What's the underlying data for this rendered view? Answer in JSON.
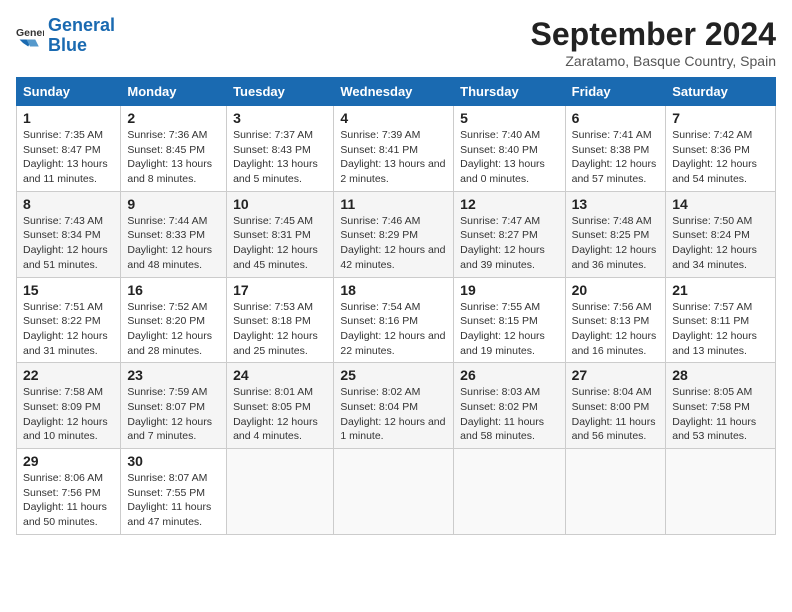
{
  "logo": {
    "name_part1": "General",
    "name_part2": "Blue"
  },
  "title": "September 2024",
  "location": "Zaratamo, Basque Country, Spain",
  "weekdays": [
    "Sunday",
    "Monday",
    "Tuesday",
    "Wednesday",
    "Thursday",
    "Friday",
    "Saturday"
  ],
  "weeks": [
    [
      {
        "day": "1",
        "sunrise": "Sunrise: 7:35 AM",
        "sunset": "Sunset: 8:47 PM",
        "daylight": "Daylight: 13 hours and 11 minutes."
      },
      {
        "day": "2",
        "sunrise": "Sunrise: 7:36 AM",
        "sunset": "Sunset: 8:45 PM",
        "daylight": "Daylight: 13 hours and 8 minutes."
      },
      {
        "day": "3",
        "sunrise": "Sunrise: 7:37 AM",
        "sunset": "Sunset: 8:43 PM",
        "daylight": "Daylight: 13 hours and 5 minutes."
      },
      {
        "day": "4",
        "sunrise": "Sunrise: 7:39 AM",
        "sunset": "Sunset: 8:41 PM",
        "daylight": "Daylight: 13 hours and 2 minutes."
      },
      {
        "day": "5",
        "sunrise": "Sunrise: 7:40 AM",
        "sunset": "Sunset: 8:40 PM",
        "daylight": "Daylight: 13 hours and 0 minutes."
      },
      {
        "day": "6",
        "sunrise": "Sunrise: 7:41 AM",
        "sunset": "Sunset: 8:38 PM",
        "daylight": "Daylight: 12 hours and 57 minutes."
      },
      {
        "day": "7",
        "sunrise": "Sunrise: 7:42 AM",
        "sunset": "Sunset: 8:36 PM",
        "daylight": "Daylight: 12 hours and 54 minutes."
      }
    ],
    [
      {
        "day": "8",
        "sunrise": "Sunrise: 7:43 AM",
        "sunset": "Sunset: 8:34 PM",
        "daylight": "Daylight: 12 hours and 51 minutes."
      },
      {
        "day": "9",
        "sunrise": "Sunrise: 7:44 AM",
        "sunset": "Sunset: 8:33 PM",
        "daylight": "Daylight: 12 hours and 48 minutes."
      },
      {
        "day": "10",
        "sunrise": "Sunrise: 7:45 AM",
        "sunset": "Sunset: 8:31 PM",
        "daylight": "Daylight: 12 hours and 45 minutes."
      },
      {
        "day": "11",
        "sunrise": "Sunrise: 7:46 AM",
        "sunset": "Sunset: 8:29 PM",
        "daylight": "Daylight: 12 hours and 42 minutes."
      },
      {
        "day": "12",
        "sunrise": "Sunrise: 7:47 AM",
        "sunset": "Sunset: 8:27 PM",
        "daylight": "Daylight: 12 hours and 39 minutes."
      },
      {
        "day": "13",
        "sunrise": "Sunrise: 7:48 AM",
        "sunset": "Sunset: 8:25 PM",
        "daylight": "Daylight: 12 hours and 36 minutes."
      },
      {
        "day": "14",
        "sunrise": "Sunrise: 7:50 AM",
        "sunset": "Sunset: 8:24 PM",
        "daylight": "Daylight: 12 hours and 34 minutes."
      }
    ],
    [
      {
        "day": "15",
        "sunrise": "Sunrise: 7:51 AM",
        "sunset": "Sunset: 8:22 PM",
        "daylight": "Daylight: 12 hours and 31 minutes."
      },
      {
        "day": "16",
        "sunrise": "Sunrise: 7:52 AM",
        "sunset": "Sunset: 8:20 PM",
        "daylight": "Daylight: 12 hours and 28 minutes."
      },
      {
        "day": "17",
        "sunrise": "Sunrise: 7:53 AM",
        "sunset": "Sunset: 8:18 PM",
        "daylight": "Daylight: 12 hours and 25 minutes."
      },
      {
        "day": "18",
        "sunrise": "Sunrise: 7:54 AM",
        "sunset": "Sunset: 8:16 PM",
        "daylight": "Daylight: 12 hours and 22 minutes."
      },
      {
        "day": "19",
        "sunrise": "Sunrise: 7:55 AM",
        "sunset": "Sunset: 8:15 PM",
        "daylight": "Daylight: 12 hours and 19 minutes."
      },
      {
        "day": "20",
        "sunrise": "Sunrise: 7:56 AM",
        "sunset": "Sunset: 8:13 PM",
        "daylight": "Daylight: 12 hours and 16 minutes."
      },
      {
        "day": "21",
        "sunrise": "Sunrise: 7:57 AM",
        "sunset": "Sunset: 8:11 PM",
        "daylight": "Daylight: 12 hours and 13 minutes."
      }
    ],
    [
      {
        "day": "22",
        "sunrise": "Sunrise: 7:58 AM",
        "sunset": "Sunset: 8:09 PM",
        "daylight": "Daylight: 12 hours and 10 minutes."
      },
      {
        "day": "23",
        "sunrise": "Sunrise: 7:59 AM",
        "sunset": "Sunset: 8:07 PM",
        "daylight": "Daylight: 12 hours and 7 minutes."
      },
      {
        "day": "24",
        "sunrise": "Sunrise: 8:01 AM",
        "sunset": "Sunset: 8:05 PM",
        "daylight": "Daylight: 12 hours and 4 minutes."
      },
      {
        "day": "25",
        "sunrise": "Sunrise: 8:02 AM",
        "sunset": "Sunset: 8:04 PM",
        "daylight": "Daylight: 12 hours and 1 minute."
      },
      {
        "day": "26",
        "sunrise": "Sunrise: 8:03 AM",
        "sunset": "Sunset: 8:02 PM",
        "daylight": "Daylight: 11 hours and 58 minutes."
      },
      {
        "day": "27",
        "sunrise": "Sunrise: 8:04 AM",
        "sunset": "Sunset: 8:00 PM",
        "daylight": "Daylight: 11 hours and 56 minutes."
      },
      {
        "day": "28",
        "sunrise": "Sunrise: 8:05 AM",
        "sunset": "Sunset: 7:58 PM",
        "daylight": "Daylight: 11 hours and 53 minutes."
      }
    ],
    [
      {
        "day": "29",
        "sunrise": "Sunrise: 8:06 AM",
        "sunset": "Sunset: 7:56 PM",
        "daylight": "Daylight: 11 hours and 50 minutes."
      },
      {
        "day": "30",
        "sunrise": "Sunrise: 8:07 AM",
        "sunset": "Sunset: 7:55 PM",
        "daylight": "Daylight: 11 hours and 47 minutes."
      },
      null,
      null,
      null,
      null,
      null
    ]
  ]
}
